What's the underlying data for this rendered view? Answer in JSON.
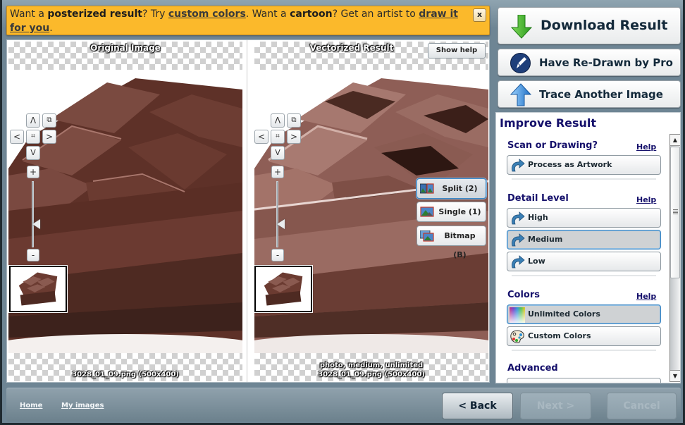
{
  "banner": {
    "t1": "Want a ",
    "b1": "posterized result",
    "t2": "? Try ",
    "link1": "custom colors",
    "t3": ". Want a ",
    "b2": "cartoon",
    "t4": "? Get an artist to ",
    "link2": "draw it for you",
    "t5": ".",
    "close_label": "x"
  },
  "viewer": {
    "left_title": "Original Image",
    "right_title": "Vectorized Result",
    "show_help_label": "Show help",
    "left_caption": "3028_01_09.png  (500x400)",
    "right_caption_line1": "photo, medium, unlimited",
    "right_caption_line2": "3028_01_09.png  (500x400)",
    "nav": {
      "up": "Λ",
      "down": "V",
      "left": "<",
      "right": ">",
      "center": "⌗",
      "fit": "⧉",
      "zoom_in": "+",
      "zoom_out": "-"
    },
    "zoom_level_fraction": 0.65,
    "modes": [
      {
        "label": "Split (2)",
        "icon": "split-view-icon",
        "active": true
      },
      {
        "label": "Single (1)",
        "icon": "single-view-icon",
        "active": false
      },
      {
        "label": "Bitmap (B)",
        "icon": "bitmap-view-icon",
        "active": false
      }
    ]
  },
  "actions": {
    "download": "Download Result",
    "redraw": "Have Re-Drawn by Pro",
    "trace": "Trace Another Image"
  },
  "improve": {
    "title": "Improve Result",
    "help_label": "Help",
    "sections": [
      {
        "title": "Scan or Drawing?",
        "options": [
          {
            "label": "Process as Artwork",
            "active": false
          }
        ]
      },
      {
        "title": "Detail Level",
        "options": [
          {
            "label": "High",
            "active": false
          },
          {
            "label": "Medium",
            "active": true
          },
          {
            "label": "Low",
            "active": false
          }
        ]
      },
      {
        "title": "Colors",
        "options": [
          {
            "label": "Unlimited Colors",
            "active": true
          },
          {
            "label": "Custom Colors",
            "active": false
          }
        ]
      },
      {
        "title": "Advanced",
        "options": []
      }
    ]
  },
  "footer": {
    "home": "Home",
    "my_images": "My images",
    "back": "< Back",
    "next": "Next >",
    "cancel": "Cancel"
  },
  "colors": {
    "banner_bg": "#fbb92b",
    "accent_blue": "#3b86c4",
    "heading": "#15106b",
    "chrome": "#6e8594"
  }
}
